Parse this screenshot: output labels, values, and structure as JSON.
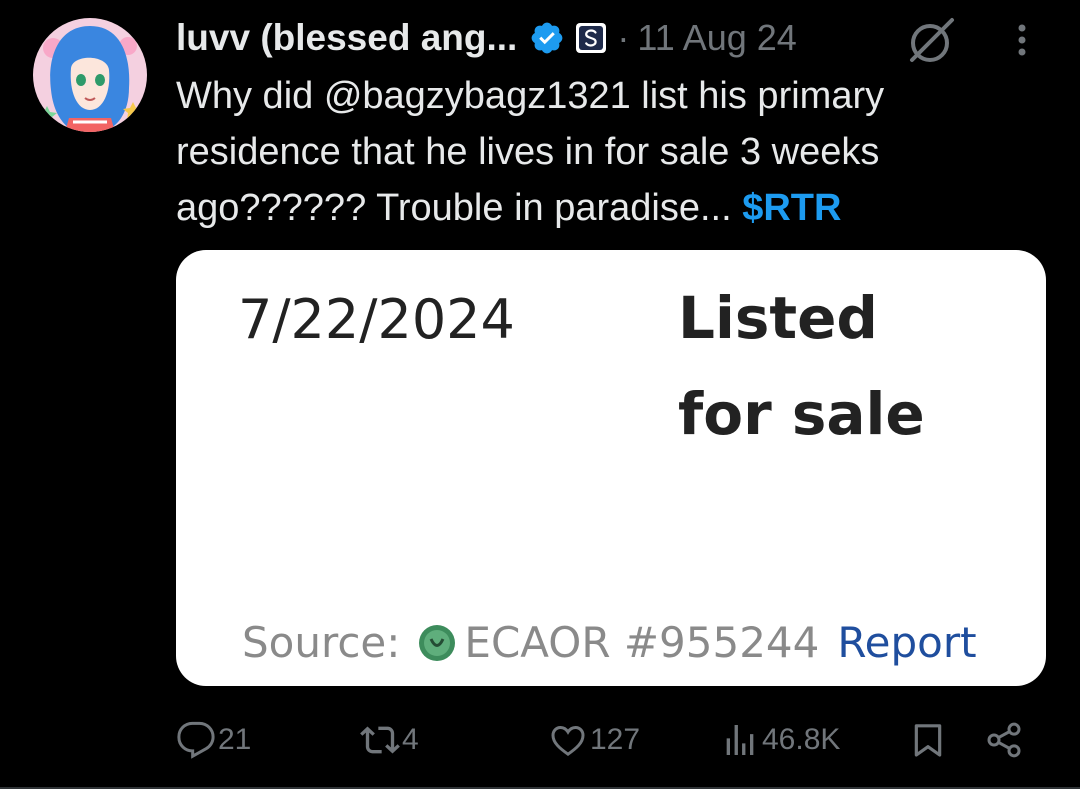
{
  "tweet": {
    "display_name": "luvv (blessed ang...",
    "date_sep": "·",
    "date": "11 Aug 24",
    "text_main": "Why did @bagzybagz1321 list his primary residence that he lives in for sale 3 weeks ago?????? Trouble in paradise... ",
    "cashtag": "$RTR"
  },
  "card": {
    "date": "7/22/2024",
    "event_line1": "Listed",
    "event_line2": "for sale",
    "source_label": "Source:",
    "source_mls": "ECAOR #955244",
    "report_link": "Report"
  },
  "actions": {
    "replies": "21",
    "reposts": "4",
    "likes": "127",
    "views": "46.8K"
  },
  "colors": {
    "background": "#000000",
    "text": "#e7e9ea",
    "muted": "#71767b",
    "accent": "#1d9bf0"
  },
  "icons": [
    "verified-badge-icon",
    "affiliate-badge-icon",
    "grok-icon",
    "more-icon",
    "reply-icon",
    "repost-icon",
    "like-icon",
    "views-icon",
    "bookmark-icon",
    "share-icon"
  ]
}
